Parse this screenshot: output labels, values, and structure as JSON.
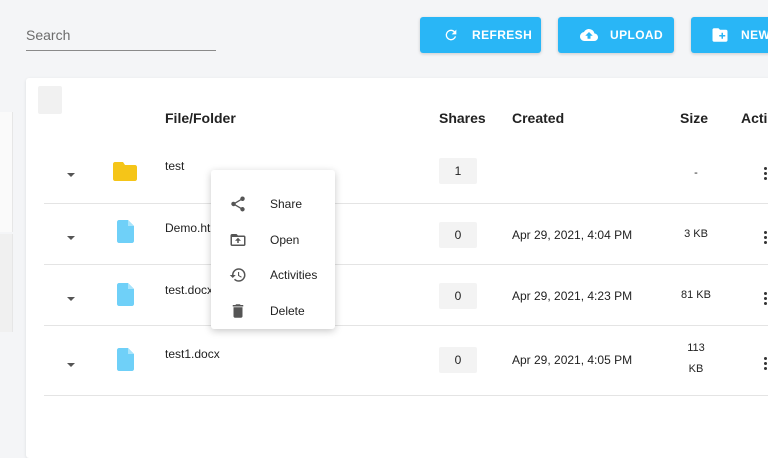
{
  "search": {
    "placeholder": "Search",
    "value": ""
  },
  "toolbar": {
    "refresh_label": "REFRESH",
    "upload_label": "UPLOAD",
    "new_label": "NEW"
  },
  "table": {
    "headers": {
      "name": "File/Folder",
      "shares": "Shares",
      "created": "Created",
      "size": "Size",
      "actions": "Actions"
    },
    "rows": [
      {
        "type": "folder",
        "name": "test",
        "shares": "1",
        "created": "",
        "size": "-"
      },
      {
        "type": "file",
        "name": "Demo.html",
        "shares": "0",
        "created": "Apr 29, 2021, 4:04 PM",
        "size": "3 KB"
      },
      {
        "type": "file",
        "name": "test.docx",
        "shares": "0",
        "created": "Apr 29, 2021, 4:23 PM",
        "size": "81 KB"
      },
      {
        "type": "file",
        "name": "test1.docx",
        "shares": "0",
        "created": "Apr 29, 2021, 4:05 PM",
        "size_line1": "113",
        "size_line2": "KB"
      }
    ]
  },
  "context_menu": {
    "items": [
      {
        "label": "Share",
        "icon": "share-icon"
      },
      {
        "label": "Open",
        "icon": "folder-open-icon"
      },
      {
        "label": "Activities",
        "icon": "history-icon"
      },
      {
        "label": "Delete",
        "icon": "trash-icon"
      }
    ]
  },
  "colors": {
    "accent": "#29b6f6",
    "folder": "#f5c518",
    "file": "#6fd0f8"
  }
}
